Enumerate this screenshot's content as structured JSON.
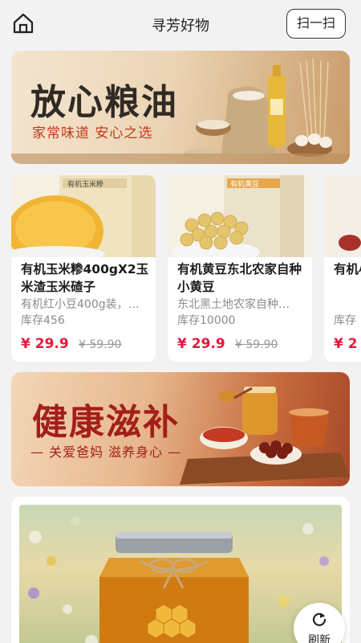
{
  "header": {
    "title": "寻芳好物",
    "scan_label": "扫一扫",
    "home_icon": "home-icon"
  },
  "banner1": {
    "title": "放心粮油",
    "subtitle": "家常味道 安心之选"
  },
  "products": [
    {
      "name": "有机玉米糁400gX2玉米渣玉米碴子",
      "desc": "有机红小豆400g装，…",
      "stock": "库存456",
      "price": "¥ 29.9",
      "old_price": "¥ 59.90",
      "package_label": "有机玉米糁"
    },
    {
      "name": "有机黄豆东北农家自种小黄豆",
      "desc": "东北黑土地农家自种…",
      "stock": "库存10000",
      "price": "¥ 29.9",
      "old_price": "¥ 59.90",
      "package_label": "有机黄豆"
    },
    {
      "name": "有机小豆",
      "desc": "库存",
      "stock": "",
      "price": "¥ 2",
      "old_price": ""
    }
  ],
  "banner2": {
    "title": "健康滋补",
    "subtitle": "— 关爱爸妈  滋养身心 —"
  },
  "refresh": {
    "label": "刷新",
    "icon": "refresh-icon"
  },
  "colors": {
    "price_red": "#e8173c",
    "background": "#f2f2f2"
  }
}
